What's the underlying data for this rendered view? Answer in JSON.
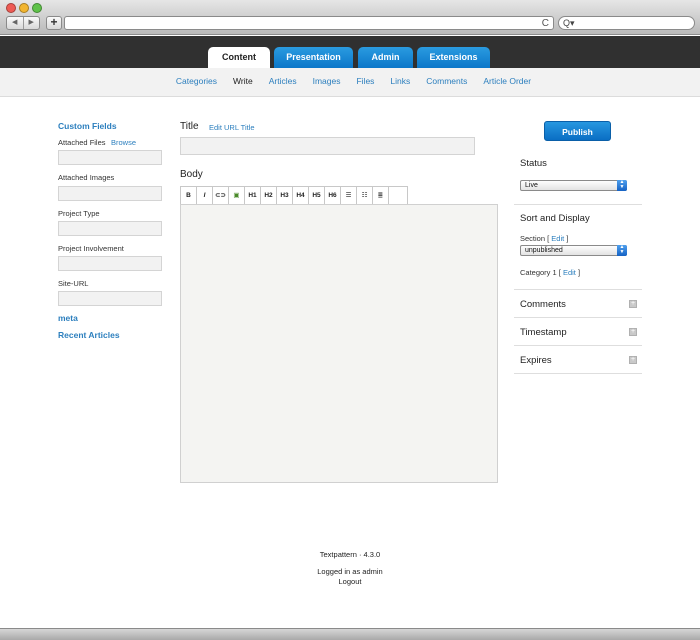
{
  "browser": {
    "back_glyph": "◀",
    "forward_glyph": "▶",
    "add_glyph": "+",
    "reload_glyph": "C",
    "search_glyph": "Q▾"
  },
  "tabs": [
    {
      "label": "Content",
      "active": true
    },
    {
      "label": "Presentation",
      "active": false
    },
    {
      "label": "Admin",
      "active": false
    },
    {
      "label": "Extensions",
      "active": false
    }
  ],
  "subnav": [
    {
      "label": "Categories"
    },
    {
      "label": "Write",
      "current": true
    },
    {
      "label": "Articles"
    },
    {
      "label": "Images"
    },
    {
      "label": "Files"
    },
    {
      "label": "Links"
    },
    {
      "label": "Comments"
    },
    {
      "label": "Article Order"
    }
  ],
  "left": {
    "heading": "Custom Fields",
    "attached_files": "Attached Files",
    "browse": "Browse",
    "attached_images": "Attached Images",
    "project_type": "Project Type",
    "project_involvement": "Project Involvement",
    "site_url": "Site-URL",
    "meta": "meta",
    "recent_articles": "Recent Articles"
  },
  "main": {
    "title_label": "Title",
    "edit_url_title": "Edit URL Title",
    "body_label": "Body",
    "toolbar": [
      "B",
      "I",
      "⊂⊃",
      "▣",
      "H1",
      "H2",
      "H3",
      "H4",
      "H5",
      "H6",
      "☰",
      "☷",
      "≣"
    ]
  },
  "right": {
    "publish": "Publish",
    "status_heading": "Status",
    "status_value": "Live",
    "sort_heading": "Sort and Display",
    "section_label": "Section",
    "section_edit": "Edit",
    "section_value": "unpublished",
    "category_label": "Category 1",
    "category_edit": "Edit",
    "comments": "Comments",
    "timestamp": "Timestamp",
    "expires": "Expires"
  },
  "footer": {
    "version": "Textpattern · 4.3.0",
    "logged_in": "Logged in as admin",
    "logout": "Logout"
  },
  "colors": {
    "accent": "#2c7fbe",
    "tab_blue": "#0a75c8",
    "dark_bar": "#303030"
  }
}
